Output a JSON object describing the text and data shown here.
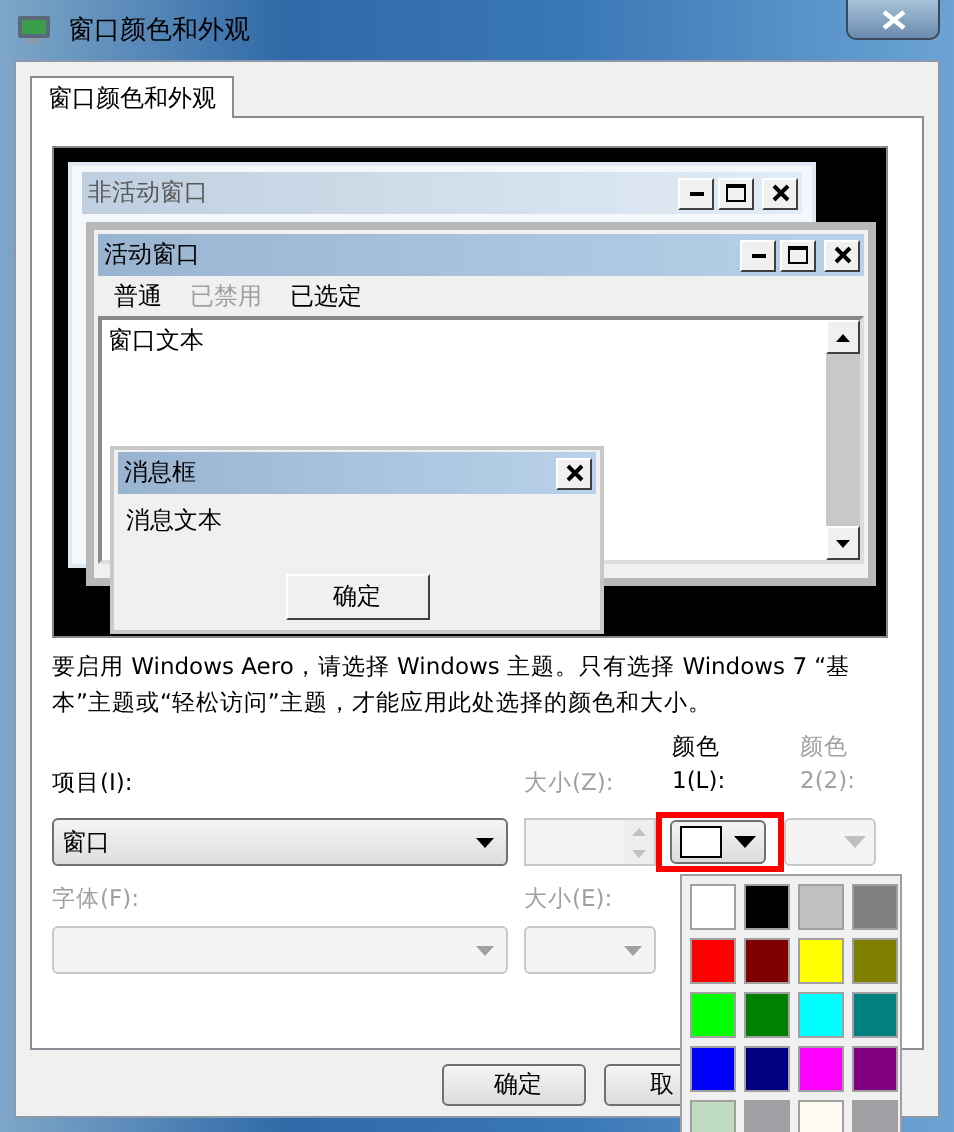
{
  "window": {
    "title": "窗口颜色和外观"
  },
  "tabs": [
    {
      "label": "窗口颜色和外观",
      "selected": true
    }
  ],
  "preview": {
    "inactive_window": {
      "title": "非活动窗口"
    },
    "active_window": {
      "title": "活动窗口",
      "menu": [
        {
          "label": "普通",
          "disabled": false
        },
        {
          "label": "已禁用",
          "disabled": true
        },
        {
          "label": "已选定",
          "disabled": false
        }
      ],
      "text": "窗口文本"
    },
    "message_box": {
      "title": "消息框",
      "text": "消息文本",
      "button": "确定"
    }
  },
  "note": "要启用 Windows Aero，请选择 Windows 主题。只有选择 Windows 7 “基本”主题或“轻松访问”主题，才能应用此处选择的颜色和大小。",
  "item": {
    "label": "项目(I):",
    "value": "窗口",
    "disabled": false
  },
  "item_size": {
    "label": "大小(Z):",
    "disabled": true
  },
  "color1": {
    "label": "颜色 1(L):",
    "disabled": false,
    "color": "#ffffff"
  },
  "color2": {
    "label": "颜色 2(2):",
    "disabled": true
  },
  "font": {
    "label": "字体(F):",
    "disabled": true
  },
  "font_size": {
    "label": "大小(E):",
    "disabled": true
  },
  "buttons": [
    {
      "label": "确定"
    },
    {
      "label": "取"
    }
  ],
  "palette": [
    {
      "color": "#ffffff"
    },
    {
      "color": "#000000"
    },
    {
      "color": "#c0c0c0"
    },
    {
      "color": "#808080"
    },
    {
      "color": "#ff0000"
    },
    {
      "color": "#800000"
    },
    {
      "color": "#ffff00"
    },
    {
      "color": "#808000"
    },
    {
      "color": "#00ff00"
    },
    {
      "color": "#008000"
    },
    {
      "color": "#00ffff"
    },
    {
      "color": "#008080"
    },
    {
      "color": "#0000ff"
    },
    {
      "color": "#000080"
    },
    {
      "color": "#ff00ff"
    },
    {
      "color": "#800080"
    },
    {
      "color": "#c0dcc0"
    },
    {
      "color": "#a0a0a4"
    },
    {
      "color": "#fffbf0"
    },
    {
      "color": "#a0a0a4"
    }
  ]
}
